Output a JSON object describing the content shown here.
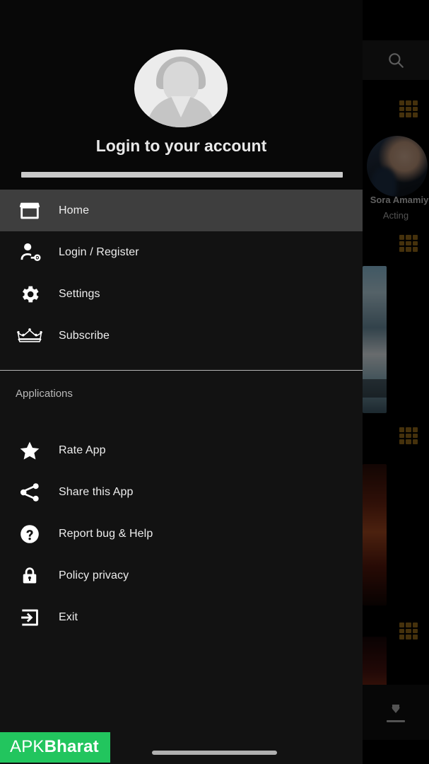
{
  "drawer": {
    "header": {
      "avatar_icon": "default-user-avatar",
      "title": "Login to your account"
    },
    "primary_items": [
      {
        "icon": "storefront-icon",
        "label": "Home",
        "active": true
      },
      {
        "icon": "person-key-icon",
        "label": "Login / Register",
        "active": false
      },
      {
        "icon": "gear-icon",
        "label": "Settings",
        "active": false
      },
      {
        "icon": "crown-icon",
        "label": "Subscribe",
        "active": false
      }
    ],
    "section_title": "Applications",
    "secondary_items": [
      {
        "icon": "star-icon",
        "label": "Rate App"
      },
      {
        "icon": "share-icon",
        "label": "Share this App"
      },
      {
        "icon": "help-circle-icon",
        "label": "Report bug & Help"
      },
      {
        "icon": "lock-icon",
        "label": "Policy privacy"
      },
      {
        "icon": "exit-icon",
        "label": "Exit"
      }
    ]
  },
  "background_app": {
    "search_icon": "search-icon",
    "profile_name": "Sora Amamiy",
    "profile_role": "Acting",
    "download_icon": "download-icon",
    "ad_grid_icon": "ad-grid-icon"
  },
  "watermark": {
    "prefix": "APK",
    "suffix": "Bharat"
  },
  "colors": {
    "drawer_bg": "#121212",
    "header_bg": "#080808",
    "active_row": "#3e3e3e",
    "accent_green": "#22c55e",
    "divider": "#d3d3d3"
  }
}
